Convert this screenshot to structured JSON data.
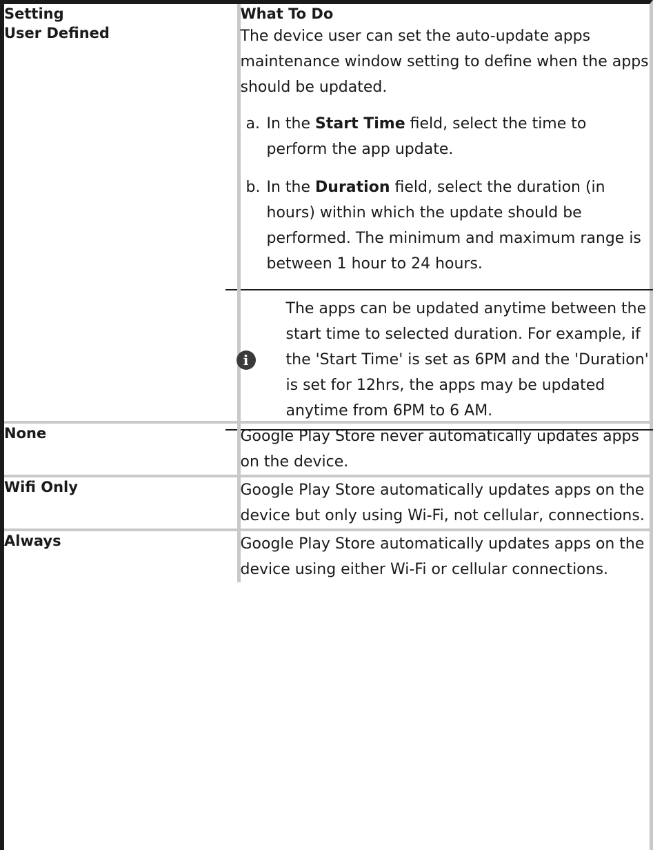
{
  "table": {
    "headers": {
      "setting": "Setting",
      "what_to_do": "What To Do"
    },
    "rows": [
      {
        "setting": "User Defined",
        "description": "The device user can set the auto-update apps maintenance window setting to define when the apps should be updated.",
        "steps": [
          {
            "marker": "a.",
            "prefix": "In the ",
            "bold": "Start Time",
            "suffix": " field, select the time to perform the app update."
          },
          {
            "marker": "b.",
            "prefix": "In the ",
            "bold": "Duration",
            "suffix": " field, select the duration (in hours) within which the update should be performed. The minimum and maximum range is between 1 hour to 24 hours."
          }
        ],
        "note": {
          "icon": "info-icon",
          "text": "The apps can be updated anytime between the start time to selected duration. For example, if the 'Start Time' is set as 6PM and the 'Duration' is set for 12hrs, the apps may be updated anytime from 6PM to 6 AM."
        }
      },
      {
        "setting": "None",
        "description": "Google Play Store never automatically updates apps on the device."
      },
      {
        "setting": "Wifi Only",
        "description": "Google Play Store automatically updates apps on the device but only using Wi-Fi, not cellular, connections."
      },
      {
        "setting": "Always",
        "description": "Google Play Store automatically updates apps on the device using either Wi-Fi or cellular connections."
      }
    ]
  },
  "colors": {
    "border_dark": "#1a1a1a",
    "grid_gray": "#c8c8c8",
    "icon_fill": "#3a3a3a"
  }
}
